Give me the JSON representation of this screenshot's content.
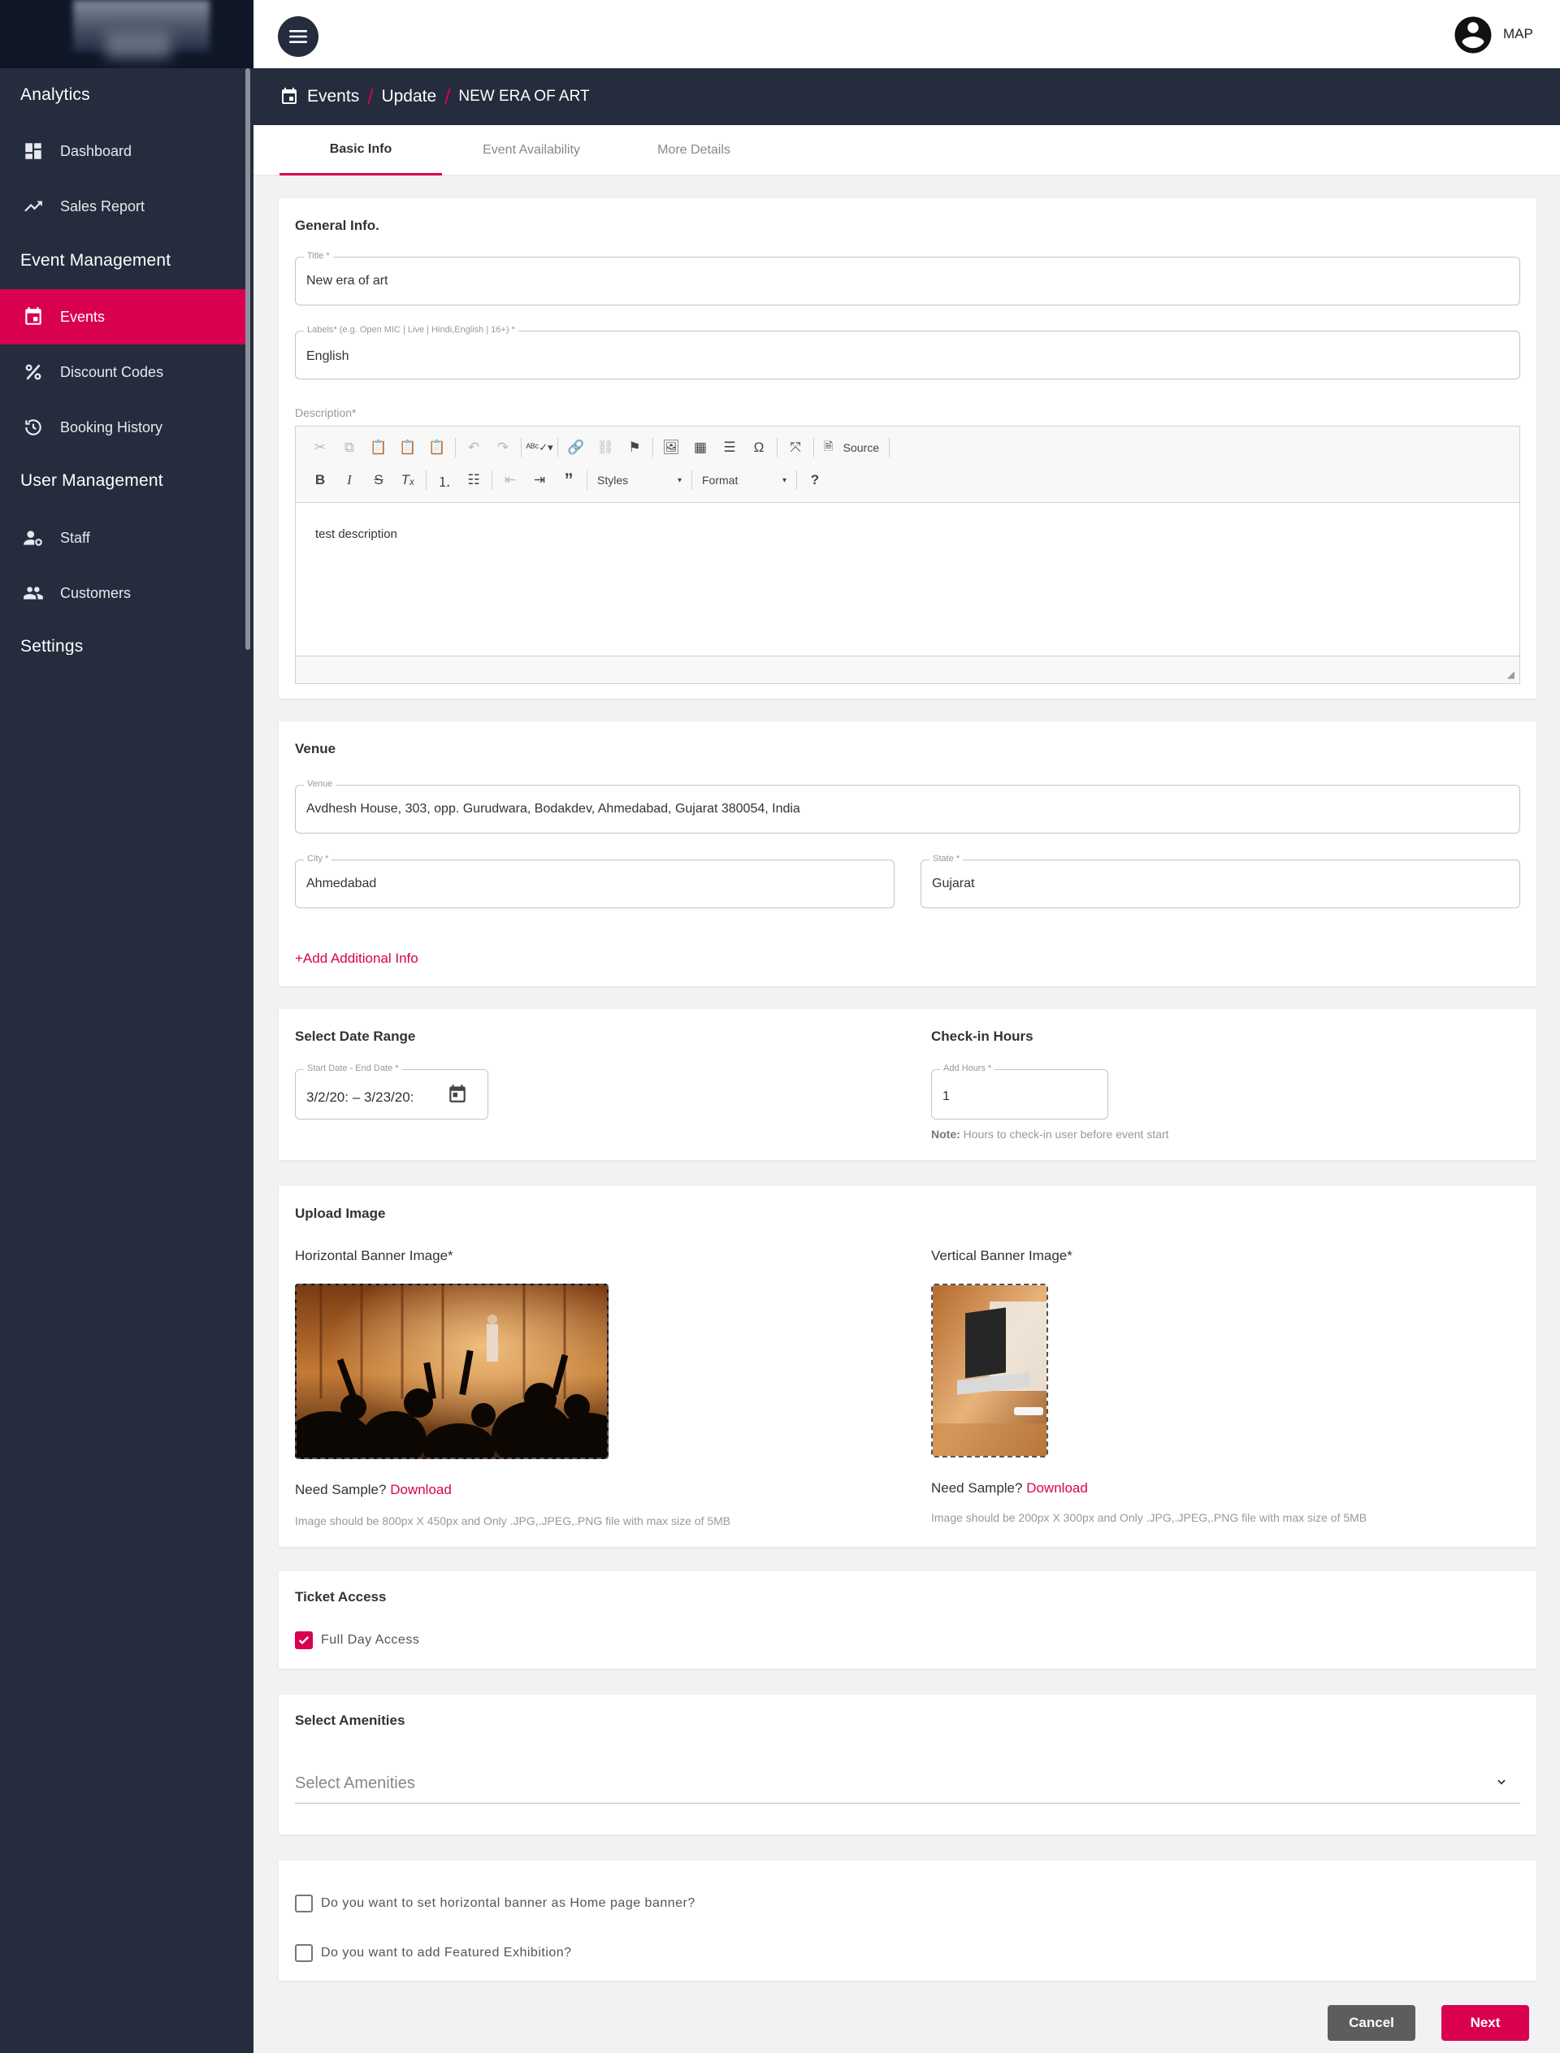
{
  "user": {
    "name": "MAP"
  },
  "sidebar": {
    "sections": [
      "Analytics",
      "Event Management",
      "User Management",
      "Settings"
    ],
    "items": [
      {
        "label": "Dashboard",
        "icon": "dashboard-icon"
      },
      {
        "label": "Sales Report",
        "icon": "trending-up-icon"
      },
      {
        "label": "Events",
        "icon": "calendar-icon",
        "active": true
      },
      {
        "label": "Discount Codes",
        "icon": "percent-icon"
      },
      {
        "label": "Booking History",
        "icon": "history-icon"
      },
      {
        "label": "Staff",
        "icon": "staff-settings-icon"
      },
      {
        "label": "Customers",
        "icon": "people-icon"
      }
    ]
  },
  "breadcrumb": {
    "items": [
      "Events",
      "Update",
      "NEW ERA OF ART"
    ]
  },
  "tabs": [
    "Basic Info",
    "Event Availability",
    "More Details"
  ],
  "general": {
    "title": "General Info.",
    "title_field": {
      "label": "Title *",
      "value": "New era of art"
    },
    "labels_field": {
      "label": "Labels* (e.g. Open MIC | Live | Hindi,English | 16+) *",
      "value": "English"
    },
    "description_label": "Description*",
    "description_value": "test description",
    "toolbar": {
      "source_label": "Source",
      "styles_label": "Styles",
      "format_label": "Format"
    }
  },
  "venue": {
    "title": "Venue",
    "venue_field": {
      "label": "Venue",
      "value": "Avdhesh House, 303, opp. Gurudwara, Bodakdev, Ahmedabad, Gujarat 380054, India"
    },
    "city_field": {
      "label": "City *",
      "value": "Ahmedabad"
    },
    "state_field": {
      "label": "State *",
      "value": "Gujarat"
    },
    "add_info": "+Add Additional Info"
  },
  "dates": {
    "title": "Select Date Range",
    "range_label": "Start Date - End Date *",
    "start": "3/2/20:",
    "dash": "–",
    "end": "3/23/20:",
    "checkin_title": "Check-in Hours",
    "hours_label": "Add Hours *",
    "hours_value": "1",
    "note_bold": "Note:",
    "note_text": " Hours to check-in user before event start"
  },
  "upload": {
    "title": "Upload Image",
    "horizontal_label": "Horizontal Banner Image*",
    "vertical_label": "Vertical Banner Image*",
    "need_sample": "Need Sample?",
    "download": "Download",
    "horizontal_hint": "Image should be 800px X 450px and Only .JPG,.JPEG,.PNG file with max size of 5MB",
    "vertical_hint": "Image should be 200px X 300px and Only .JPG,.JPEG,.PNG file with max size of 5MB"
  },
  "ticket": {
    "title": "Ticket Access",
    "full_day": "Full Day Access",
    "full_day_checked": true
  },
  "amenities": {
    "title": "Select Amenities",
    "placeholder": "Select Amenities"
  },
  "options": {
    "home_banner": "Do you want to set horizontal banner as Home page banner?",
    "featured": "Do you want to add Featured Exhibition?"
  },
  "actions": {
    "cancel": "Cancel",
    "next": "Next"
  },
  "colors": {
    "accent": "#d9004f",
    "sidebar": "#252c3d"
  }
}
